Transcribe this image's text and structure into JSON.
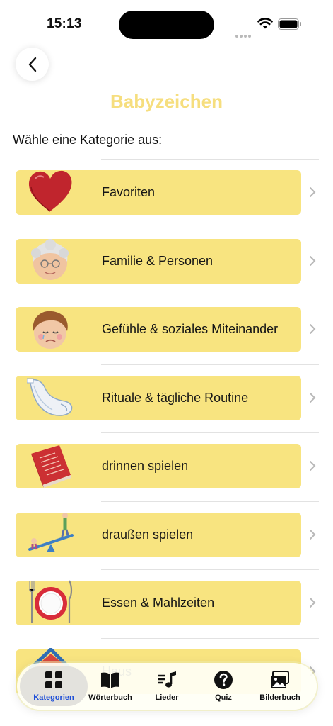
{
  "status_bar": {
    "time": "15:13"
  },
  "header": {
    "title": "Babyzeichen",
    "subtitle": "Wähle eine Kategorie aus:"
  },
  "colors": {
    "card": "#f8e480",
    "title": "#f6de7e",
    "active_tab": "#1e4fd8"
  },
  "categories": [
    {
      "label": "Favoriten",
      "icon": "heart-icon"
    },
    {
      "label": "Familie & Personen",
      "icon": "grandmother-icon"
    },
    {
      "label": "Gefühle & soziales Miteinander",
      "icon": "crying-child-icon"
    },
    {
      "label": "Rituale & tägliche Routine",
      "icon": "diaper-icon"
    },
    {
      "label": "drinnen spielen",
      "icon": "book-icon"
    },
    {
      "label": "draußen spielen",
      "icon": "seesaw-icon"
    },
    {
      "label": "Essen & Mahlzeiten",
      "icon": "plate-cutlery-icon"
    },
    {
      "label": "Haus",
      "icon": "house-icon"
    }
  ],
  "tabs": [
    {
      "label": "Kategorien",
      "icon": "grid-icon",
      "active": true
    },
    {
      "label": "Wörterbuch",
      "icon": "open-book-icon",
      "active": false
    },
    {
      "label": "Lieder",
      "icon": "music-list-icon",
      "active": false
    },
    {
      "label": "Quiz",
      "icon": "question-icon",
      "active": false
    },
    {
      "label": "Bilderbuch",
      "icon": "photo-stack-icon",
      "active": false
    }
  ]
}
